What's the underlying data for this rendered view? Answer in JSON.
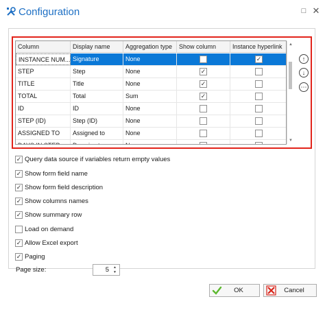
{
  "window": {
    "title": "Configuration",
    "maximize_glyph": "□",
    "close_glyph": "✕"
  },
  "grid": {
    "columns": [
      "Column",
      "Display name",
      "Aggregation type",
      "Show column",
      "Instance hyperlink"
    ],
    "rows": [
      {
        "column": "INSTANCE NUM...",
        "display_name": "Signature",
        "aggregation": "None",
        "show_column": false,
        "instance_hyperlink": true,
        "selected": true
      },
      {
        "column": "STEP",
        "display_name": "Step",
        "aggregation": "None",
        "show_column": true,
        "instance_hyperlink": false
      },
      {
        "column": "TITLE",
        "display_name": "Title",
        "aggregation": "None",
        "show_column": true,
        "instance_hyperlink": false
      },
      {
        "column": "TOTAL",
        "display_name": "Total",
        "aggregation": "Sum",
        "show_column": true,
        "instance_hyperlink": false
      },
      {
        "column": "ID",
        "display_name": "ID",
        "aggregation": "None",
        "show_column": false,
        "instance_hyperlink": false
      },
      {
        "column": "STEP (ID)",
        "display_name": "Step (ID)",
        "aggregation": "None",
        "show_column": false,
        "instance_hyperlink": false
      },
      {
        "column": "ASSIGNED TO",
        "display_name": "Assigned to",
        "aggregation": "None",
        "show_column": false,
        "instance_hyperlink": false
      },
      {
        "column": "DAYS IN STEP",
        "display_name": "Days in step",
        "aggregation": "None",
        "show_column": false,
        "instance_hyperlink": false
      }
    ]
  },
  "side_buttons": {
    "up_glyph": "↑",
    "down_glyph": "↓",
    "more_glyph": "⋯"
  },
  "options": [
    {
      "label": "Query data source if variables return empty values",
      "checked": true
    },
    {
      "label": "Show form field name",
      "checked": true
    },
    {
      "label": "Show form field description",
      "checked": true
    },
    {
      "label": "Show columns names",
      "checked": true
    },
    {
      "label": "Show summary row",
      "checked": true
    },
    {
      "label": "Load on demand",
      "checked": false
    },
    {
      "label": "Allow Excel export",
      "checked": true
    },
    {
      "label": "Paging",
      "checked": true
    }
  ],
  "page_size": {
    "label": "Page size:",
    "value": "5"
  },
  "buttons": {
    "ok": "OK",
    "cancel": "Cancel"
  },
  "colors": {
    "accent_title": "#1d6fc4",
    "highlight_border": "#e2231a",
    "selected_row": "#0a78d7",
    "ok_icon": "#5cb82e",
    "cancel_icon": "#d9261c"
  }
}
